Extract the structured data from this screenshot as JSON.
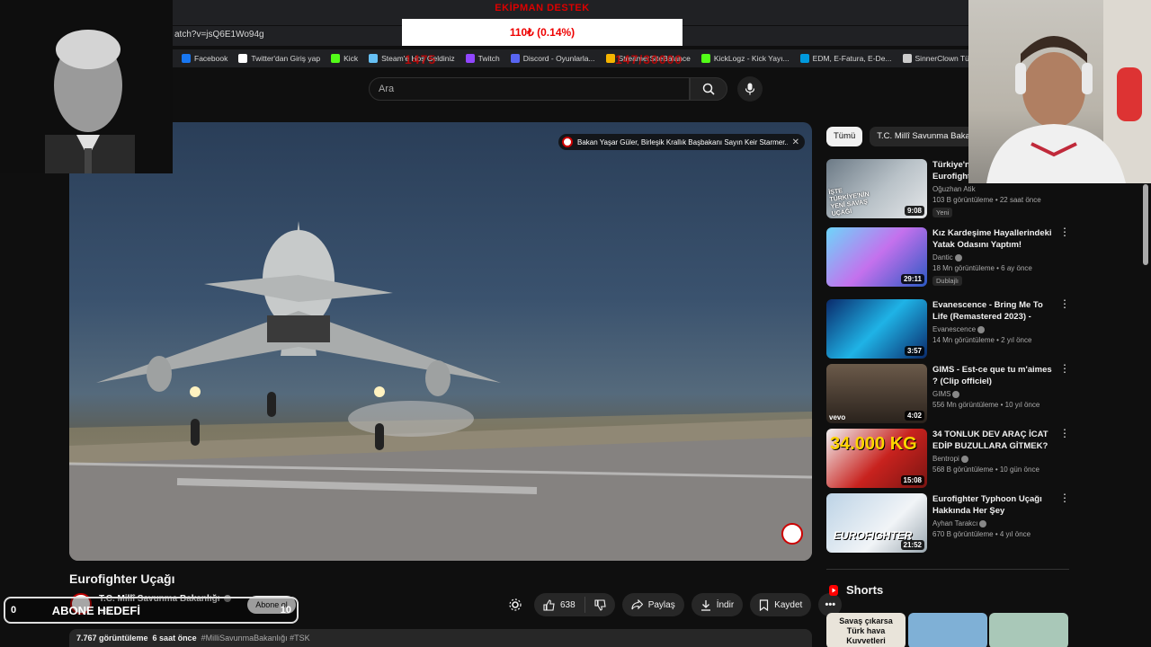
{
  "browser": {
    "url": "atch?v=jsQ6E1Wo94g",
    "bookmarks": [
      {
        "label": "Facebook",
        "color": "#1877f2"
      },
      {
        "label": "Twitter'dan Giriş yap",
        "color": "#ffffff"
      },
      {
        "label": "Kick",
        "color": "#53fc18"
      },
      {
        "label": "Steam'e Hoş Geldiniz",
        "color": "#66c0f4"
      },
      {
        "label": "Twitch",
        "color": "#9146ff"
      },
      {
        "label": "Discord - Oyunlarla...",
        "color": "#5865f2"
      },
      {
        "label": "StreamerSiteBalance",
        "color": "#f5b400"
      },
      {
        "label": "KickLogz - Kick Yayı...",
        "color": "#53fc18"
      },
      {
        "label": "EDM, E-Fatura, E-De...",
        "color": "#0099dd"
      },
      {
        "label": "SinnerClown Türkçe...",
        "color": "#cccccc"
      }
    ]
  },
  "donation": {
    "title": "EKİPMAN DESTEK",
    "amount": "110₺ (0.14%)",
    "overlay_left": "1475",
    "overlay_right": "147/30000"
  },
  "search": {
    "placeholder": "Ara",
    "search_icon": "search-icon",
    "mic_icon": "mic-icon"
  },
  "notification": {
    "text": "Bakan Yaşar Güler, Birleşik Krallık Başbakanı Sayın Keir Starmer..."
  },
  "video": {
    "title": "Eurofighter Uçağı",
    "channel": "T.C. Millî Savunma Bakanlığı",
    "subscribers": "336",
    "subscribe_label": "Abone ol",
    "likes": "638",
    "share_label": "Paylaş",
    "download_label": "İndir",
    "save_label": "Kaydet",
    "views": "7.767 görüntüleme",
    "age": "6 saat önce",
    "tags": "#MilliSavunmaBakanlığı #TSK"
  },
  "goal": {
    "current": "0",
    "label": "ABONE HEDEFİ",
    "target": "10"
  },
  "sidebar": {
    "chips": [
      "Tümü",
      "T.C. Millî Savunma Bakanlığı"
    ],
    "recommendations": [
      {
        "title": "Türkiye'nin Yeni Savaş Uçağı Eurofighter",
        "channel": "Oğuzhan Atik",
        "meta": "103 B görüntüleme • 22 saat önce",
        "duration": "9:08",
        "badge": "Yeni",
        "verified": false
      },
      {
        "title": "Kız Kardeşime Hayallerindeki Yatak Odasını Yaptım!",
        "channel": "Dantic",
        "meta": "18 Mn görüntüleme • 6 ay önce",
        "duration": "29:11",
        "badge": "Dublajlı",
        "verified": true
      },
      {
        "title": "Evanescence - Bring Me To Life (Remastered 2023) - Official ...",
        "channel": "Evanescence",
        "meta": "14 Mn görüntüleme • 2 yıl önce",
        "duration": "3:57",
        "badge": "",
        "verified": true
      },
      {
        "title": "GIMS - Est-ce que tu m'aimes ? (Clip officiel)",
        "channel": "GIMS",
        "meta": "556 Mn görüntüleme • 10 yıl önce",
        "duration": "4:02",
        "badge": "",
        "verified": true
      },
      {
        "title": "34 TONLUK DEV ARAÇ İCAT EDİP BUZULLARA GİTMEK?",
        "channel": "Bentropi",
        "meta": "568 B görüntüleme • 10 gün önce",
        "duration": "15:08",
        "badge": "",
        "verified": true
      },
      {
        "title": "Eurofighter Typhoon Uçağı Hakkında Her Şey",
        "channel": "Ayhan Tarakcı",
        "meta": "670 B görüntüleme • 4 yıl önce",
        "duration": "21:52",
        "badge": "",
        "verified": true
      }
    ],
    "shorts_label": "Shorts",
    "shorts": [
      {
        "text": "Savaş çıkarsa Türk hava Kuvvetleri",
        "bg": "#e9e4da"
      },
      {
        "text": "",
        "bg": "#7fb0d6"
      },
      {
        "text": "",
        "bg": "#a9c8b8"
      }
    ],
    "thumb_texts": {
      "t1": "İŞTE TÜRKİYE'NİN YENİ SAVAŞ UÇAĞI",
      "t5": "34.000 KG",
      "t6": "EUROFIGHTER",
      "vevo": "vevo"
    }
  },
  "colors": {
    "bg": "#0f0f0f",
    "accent_red": "#ff0000",
    "chip_bg": "#272727"
  }
}
